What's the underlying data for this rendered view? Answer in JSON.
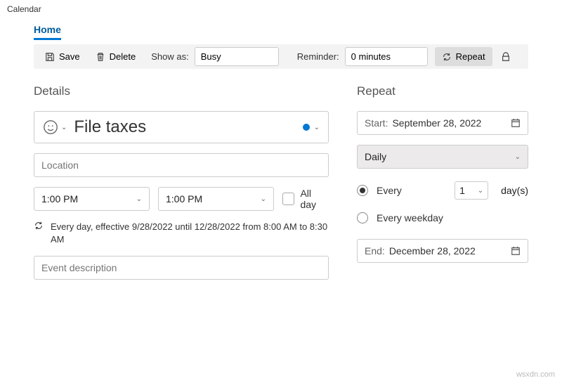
{
  "app": {
    "title": "Calendar"
  },
  "tabs": {
    "home": "Home"
  },
  "toolbar": {
    "save": "Save",
    "delete": "Delete",
    "showas_label": "Show as:",
    "showas_value": "Busy",
    "reminder_label": "Reminder:",
    "reminder_value": "0 minutes",
    "repeat": "Repeat"
  },
  "details": {
    "heading": "Details",
    "title_value": "File taxes",
    "location_placeholder": "Location",
    "start_time": "1:00 PM",
    "end_time": "1:00 PM",
    "allday_label": "All day",
    "recurrence_text": "Every day, effective 9/28/2022 until 12/28/2022 from 8:00 AM to 8:30 AM",
    "desc_placeholder": "Event description"
  },
  "repeat": {
    "heading": "Repeat",
    "start_label": "Start:",
    "start_value": "September 28, 2022",
    "frequency": "Daily",
    "every_label": "Every",
    "every_value": "1",
    "days_label": "day(s)",
    "weekday_label": "Every weekday",
    "end_label": "End:",
    "end_value": "December 28, 2022"
  },
  "watermark": "wsxdn.com"
}
